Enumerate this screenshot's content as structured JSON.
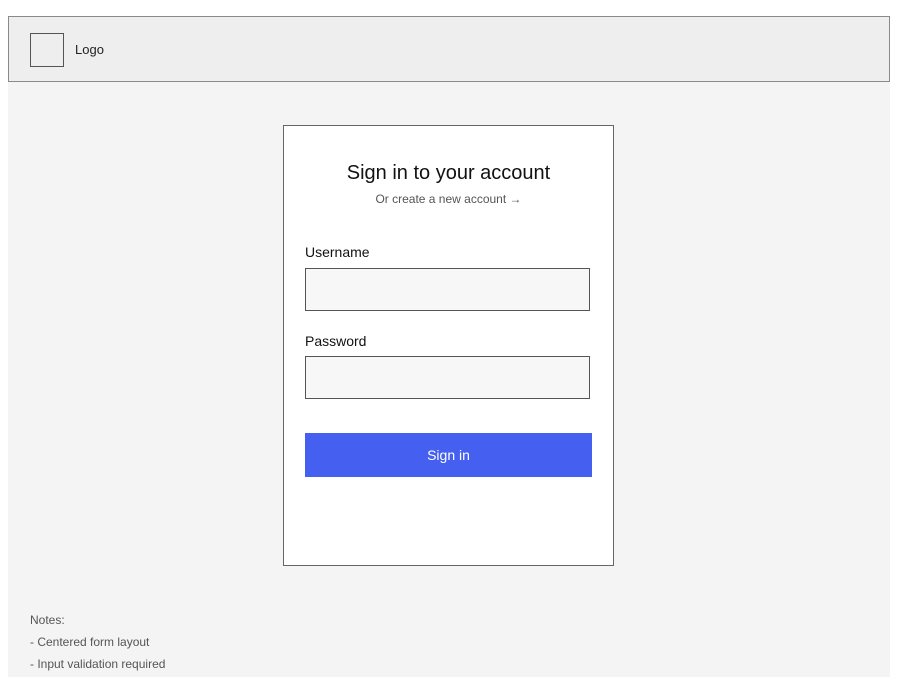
{
  "header": {
    "logo_label": "Logo"
  },
  "signin_card": {
    "title": "Sign in to your account",
    "subtitle": "Or create a new account →",
    "username": {
      "label": "Username",
      "value": "",
      "placeholder": ""
    },
    "password": {
      "label": "Password",
      "value": "",
      "placeholder": ""
    },
    "submit_label": "Sign in"
  },
  "notes": {
    "heading": "Notes:",
    "items": [
      "- Centered form layout",
      "- Input validation required"
    ]
  },
  "colors": {
    "background": "#f4f4f4",
    "header_background": "#eeeeee",
    "card_background": "#ffffff",
    "input_background": "#f7f7f7",
    "primary_button": "#4560f0"
  }
}
